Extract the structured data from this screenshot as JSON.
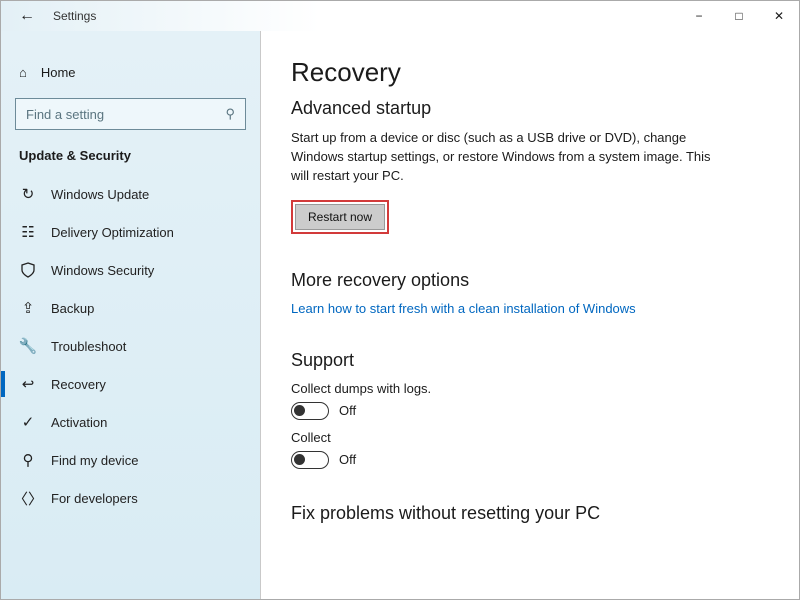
{
  "window": {
    "app_title": "Settings"
  },
  "sidebar": {
    "home_label": "Home",
    "search_placeholder": "Find a setting",
    "category_label": "Update & Security",
    "items": [
      {
        "label": "Windows Update"
      },
      {
        "label": "Delivery Optimization"
      },
      {
        "label": "Windows Security"
      },
      {
        "label": "Backup"
      },
      {
        "label": "Troubleshoot"
      },
      {
        "label": "Recovery"
      },
      {
        "label": "Activation"
      },
      {
        "label": "Find my device"
      },
      {
        "label": "For developers"
      }
    ]
  },
  "main": {
    "page_title": "Recovery",
    "advanced": {
      "heading": "Advanced startup",
      "desc": "Start up from a device or disc (such as a USB drive or DVD), change Windows startup settings, or restore Windows from a system image. This will restart your PC.",
      "button_label": "Restart now"
    },
    "more": {
      "heading": "More recovery options",
      "link_text": "Learn how to start fresh with a clean installation of Windows"
    },
    "support": {
      "heading": "Support",
      "row1_label": "Collect dumps with logs.",
      "row1_state": "Off",
      "row2_label": "Collect",
      "row2_state": "Off"
    },
    "fix_heading": "Fix problems without resetting your PC"
  }
}
